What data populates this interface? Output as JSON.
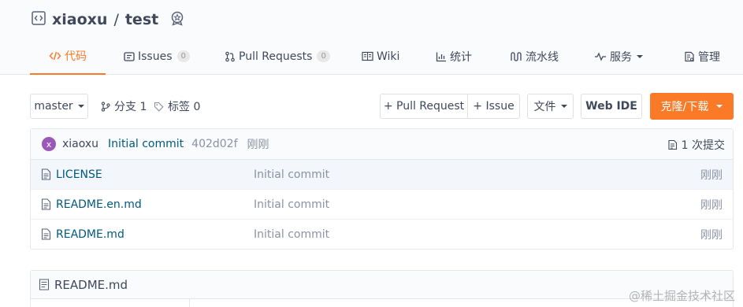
{
  "repo": {
    "owner": "xiaoxu",
    "separator": "/",
    "name": "test"
  },
  "tabs": [
    {
      "label": "代码"
    },
    {
      "label": "Issues",
      "count": "0"
    },
    {
      "label": "Pull Requests",
      "count": "0"
    },
    {
      "label": "Wiki"
    },
    {
      "label": "统计"
    },
    {
      "label": "流水线"
    },
    {
      "label": "服务"
    },
    {
      "label": "管理"
    }
  ],
  "toolbar": {
    "branch": "master",
    "branches_label": "分支 1",
    "tags_label": "标签 0",
    "pull_request_label": "+ Pull Request",
    "issue_label": "+ Issue",
    "files_label": "文件",
    "webide_label": "Web IDE",
    "clone_label": "克隆/下载"
  },
  "commit": {
    "avatar_letter": "x",
    "author": "xiaoxu",
    "message": "Initial commit",
    "sha": "402d02f",
    "time": "刚刚",
    "count_label": "1 次提交"
  },
  "files": [
    {
      "name": "LICENSE",
      "message": "Initial commit",
      "time": "刚刚"
    },
    {
      "name": "README.en.md",
      "message": "Initial commit",
      "time": "刚刚"
    },
    {
      "name": "README.md",
      "message": "Initial commit",
      "time": "刚刚"
    }
  ],
  "readme": {
    "title": "README.md"
  },
  "watermark": "@稀土掘金技术社区",
  "colors": {
    "accent": "#fa7a28",
    "link": "#005980",
    "muted": "#8c92a4"
  }
}
